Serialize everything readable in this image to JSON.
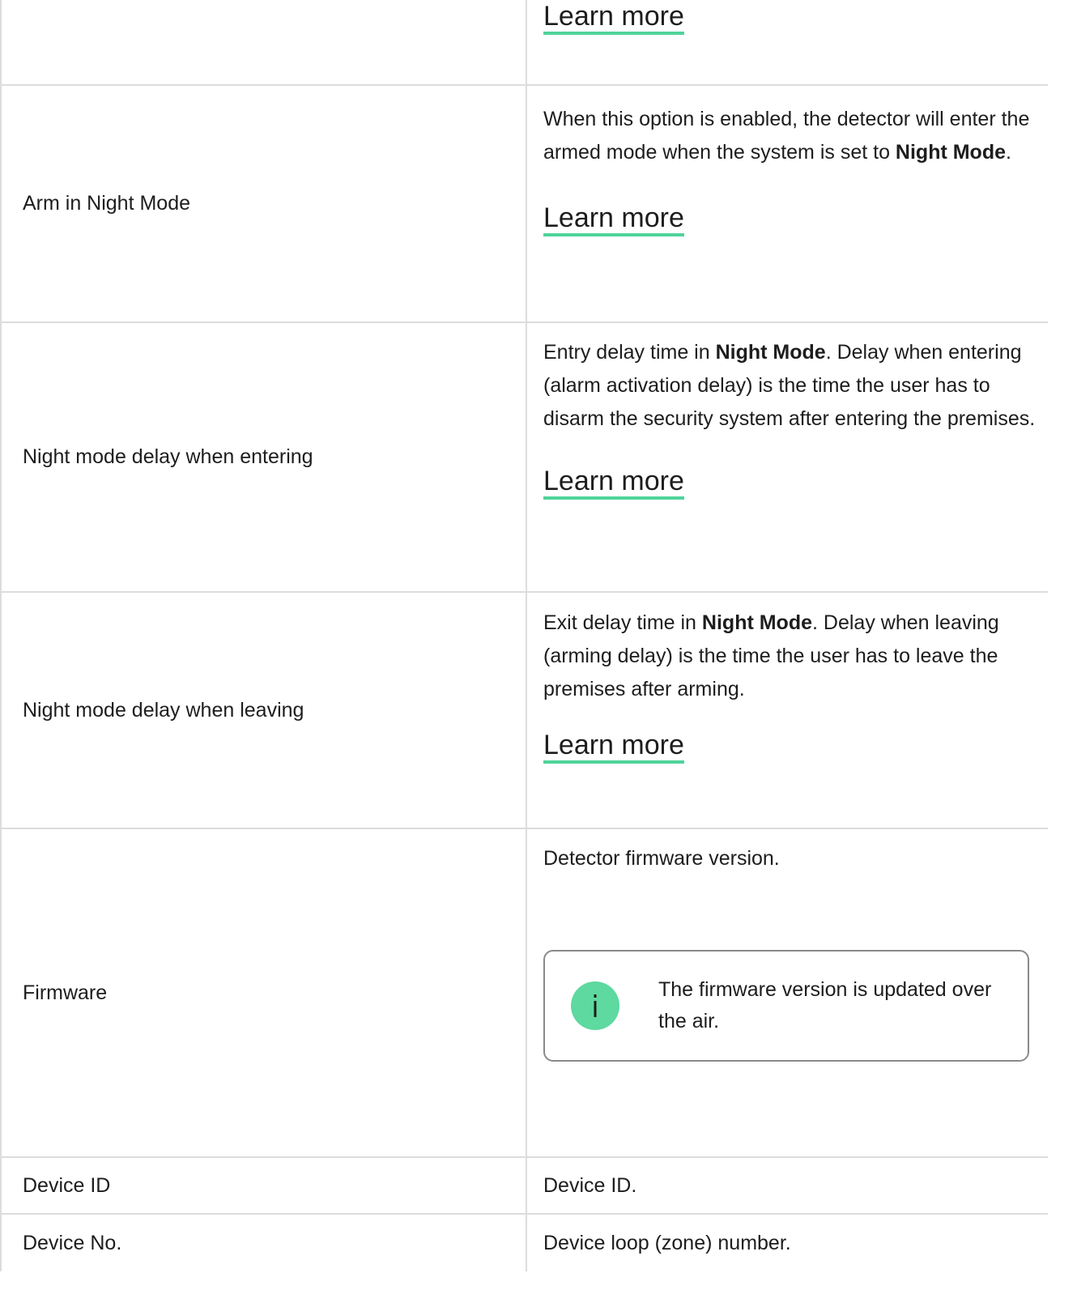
{
  "rows": [
    {
      "label": "",
      "learn_more": "Learn more"
    },
    {
      "label": "Arm in Night Mode",
      "desc_before": "When this option is enabled, the detector will enter the armed mode when the system is set to ",
      "desc_bold": "Night Mode",
      "desc_after": ".",
      "learn_more": "Learn more"
    },
    {
      "label": "Night mode delay when entering",
      "desc_before": "Entry delay time in ",
      "desc_bold": "Night Mode",
      "desc_after": ". Delay when entering (alarm activation delay) is the time the user has to disarm the security system after entering the premises.",
      "learn_more": "Learn more"
    },
    {
      "label": "Night mode delay when leaving",
      "desc_before": "Exit delay time in ",
      "desc_bold": "Night Mode",
      "desc_after": ". Delay when leaving (arming delay) is the time the user has to leave the premises after arming.",
      "learn_more": "Learn more"
    },
    {
      "label": "Firmware",
      "desc": "Detector firmware version.",
      "notice": "The firmware version is updated over the air.",
      "notice_icon": "info-icon"
    },
    {
      "label": "Device ID",
      "desc": "Device ID."
    },
    {
      "label": "Device No.",
      "desc": "Device loop (zone) number."
    }
  ],
  "colors": {
    "accent": "#4fd49a",
    "info_icon": "#5ed99f",
    "border": "#dcdcdc",
    "text": "#1d1d1d"
  }
}
